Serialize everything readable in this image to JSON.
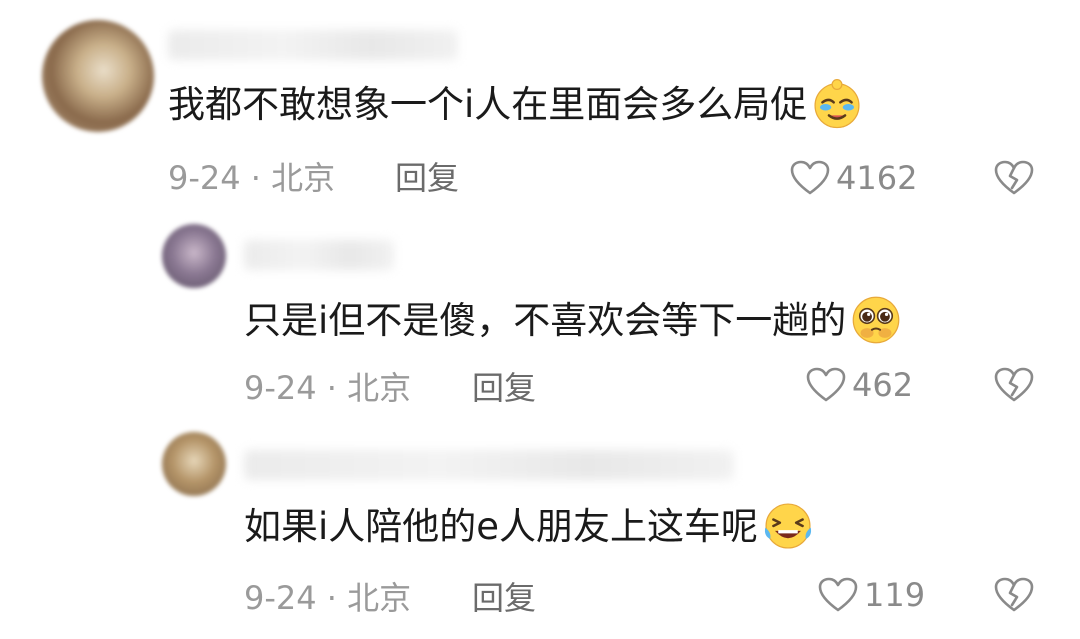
{
  "comments": [
    {
      "text": "我都不敢想象一个i人在里面会多么局促",
      "emoji": "crying-face-emoji",
      "meta": "9-24 · 北京",
      "reply_label": "回复",
      "likes": "4162"
    },
    {
      "text": "只是i但不是傻，不喜欢会等下一趟的",
      "emoji": "pleading-face-emoji",
      "meta": "9-24 · 北京",
      "reply_label": "回复",
      "likes": "462"
    },
    {
      "text": "如果i人陪他的e人朋友上这车呢",
      "emoji": "laughing-tears-emoji",
      "meta": "9-24 · 北京",
      "reply_label": "回复",
      "likes": "119"
    }
  ],
  "icons": {
    "like": "heart-outline-icon",
    "dislike": "broken-heart-icon"
  },
  "colors": {
    "text": "#1a1a1a",
    "meta": "#9a9a9a",
    "icon": "#8a8a8a",
    "emoji_face": "#ffd54a"
  }
}
